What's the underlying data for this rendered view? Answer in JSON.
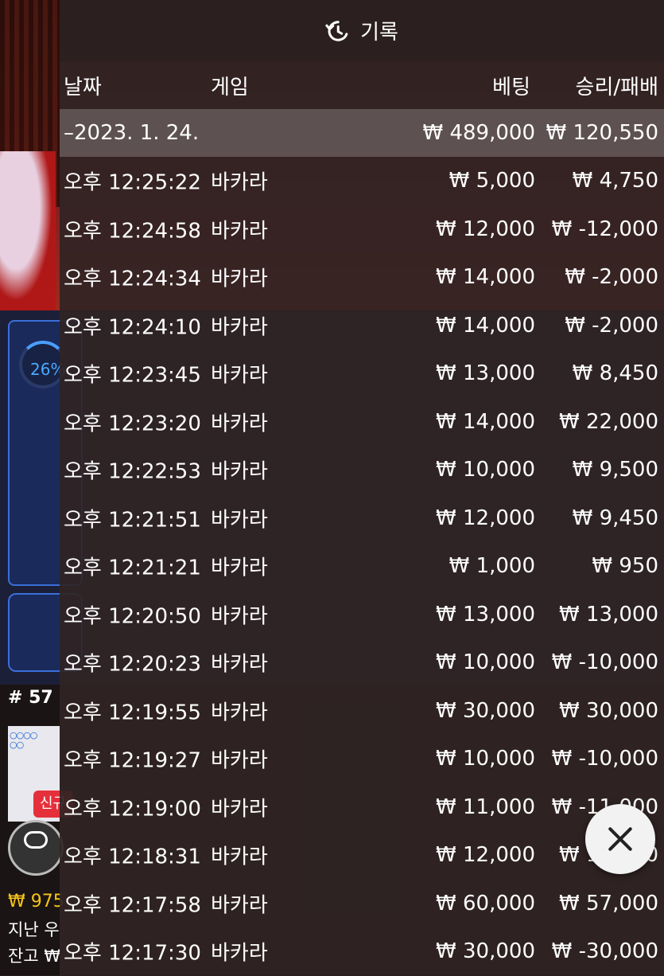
{
  "header": {
    "title": "기록"
  },
  "columns": {
    "date": "날짜",
    "game": "게임",
    "bet": "베팅",
    "result": "승리/패배"
  },
  "summary": {
    "date": "–2023. 1. 24.",
    "bet": "₩ 489,000",
    "result": "₩ 120,550"
  },
  "rows": [
    {
      "time": "오후 12:25:22",
      "game": "바카라",
      "bet": "₩ 5,000",
      "result": "₩ 4,750"
    },
    {
      "time": "오후 12:24:58",
      "game": "바카라",
      "bet": "₩ 12,000",
      "result": "₩ -12,000"
    },
    {
      "time": "오후 12:24:34",
      "game": "바카라",
      "bet": "₩ 14,000",
      "result": "₩ -2,000"
    },
    {
      "time": "오후 12:24:10",
      "game": "바카라",
      "bet": "₩ 14,000",
      "result": "₩ -2,000"
    },
    {
      "time": "오후 12:23:45",
      "game": "바카라",
      "bet": "₩ 13,000",
      "result": "₩ 8,450"
    },
    {
      "time": "오후 12:23:20",
      "game": "바카라",
      "bet": "₩ 14,000",
      "result": "₩ 22,000"
    },
    {
      "time": "오후 12:22:53",
      "game": "바카라",
      "bet": "₩ 10,000",
      "result": "₩ 9,500"
    },
    {
      "time": "오후 12:21:51",
      "game": "바카라",
      "bet": "₩ 12,000",
      "result": "₩ 9,450"
    },
    {
      "time": "오후 12:21:21",
      "game": "바카라",
      "bet": "₩ 1,000",
      "result": "₩ 950"
    },
    {
      "time": "오후 12:20:50",
      "game": "바카라",
      "bet": "₩ 13,000",
      "result": "₩ 13,000"
    },
    {
      "time": "오후 12:20:23",
      "game": "바카라",
      "bet": "₩ 10,000",
      "result": "₩ -10,000"
    },
    {
      "time": "오후 12:19:55",
      "game": "바카라",
      "bet": "₩ 30,000",
      "result": "₩ 30,000"
    },
    {
      "time": "오후 12:19:27",
      "game": "바카라",
      "bet": "₩ 10,000",
      "result": "₩ -10,000"
    },
    {
      "time": "오후 12:19:00",
      "game": "바카라",
      "bet": "₩ 11,000",
      "result": "₩ -11,000"
    },
    {
      "time": "오후 12:18:31",
      "game": "바카라",
      "bet": "₩ 12,000",
      "result": "₩ 12,000"
    },
    {
      "time": "오후 12:17:58",
      "game": "바카라",
      "bet": "₩ 60,000",
      "result": "₩ 57,000"
    },
    {
      "time": "오후 12:17:30",
      "game": "바카라",
      "bet": "₩ 30,000",
      "result": "₩ -30,000"
    }
  ],
  "background": {
    "win_percent": "26%",
    "round": "# 57",
    "new_badge": "신규",
    "balance_partial": "₩ 975",
    "last_win_label": "지난 우",
    "balance_label": "잔고 ₩"
  },
  "colors": {
    "panel_bg": "#302424",
    "accent_blue": "#3b6fd8",
    "badge_red": "#e5303c",
    "balance_yellow": "#f5c518"
  }
}
